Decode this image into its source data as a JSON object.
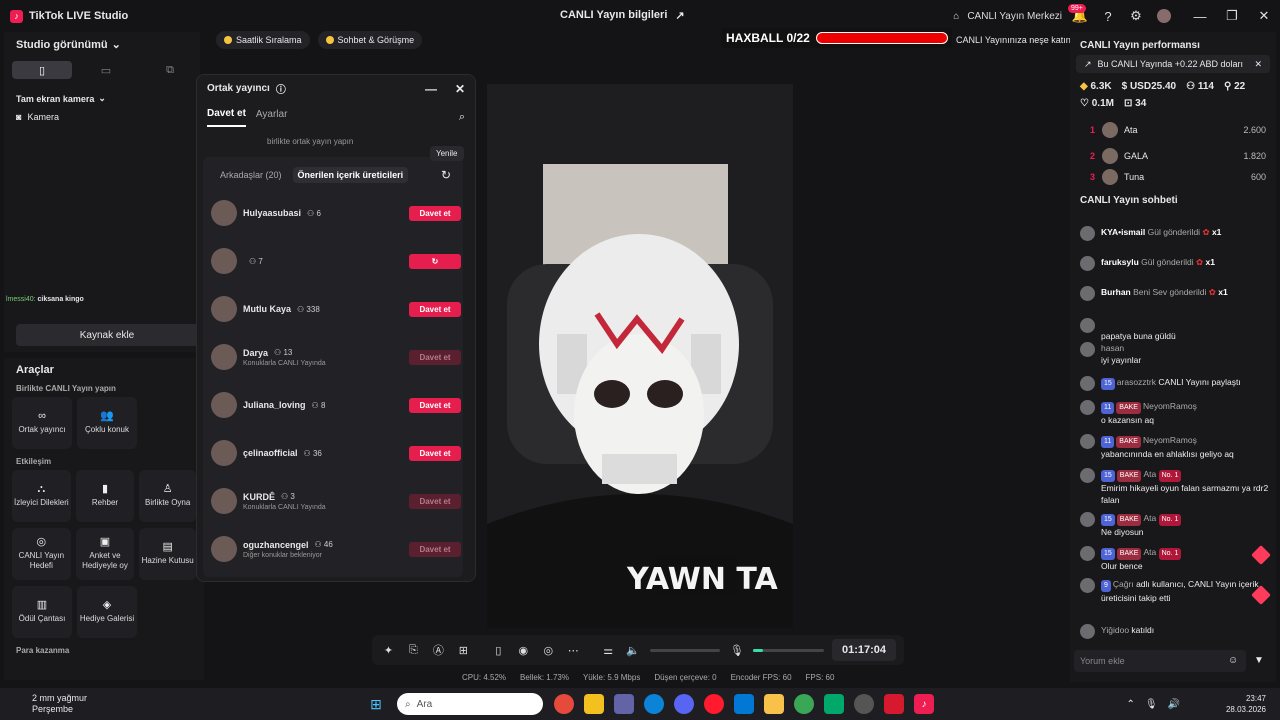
{
  "app": {
    "title": "TikTok LIVE Studio",
    "center_title": "CANLI Yayın bilgileri",
    "center_link": "CANLI Yayın Merkezi",
    "badge": "99+"
  },
  "left": {
    "view": "Studio görünümü",
    "scene": "Tam ekran kamera",
    "source": "Kamera",
    "chat_user": "lmessi40:",
    "chat_text": "ciksana kingo",
    "add_source": "Kaynak ekle"
  },
  "tools": {
    "title": "Araçlar",
    "sec1": "Birlikte CANLI Yayın yapın",
    "sec2": "Etkileşim",
    "sec3": "Para kazanma",
    "cards1": [
      "Ortak yayıncı",
      "Çoklu konuk"
    ],
    "cards2": [
      "İzleyici Dilekleri",
      "Rehber",
      "Birlikte Oyna"
    ],
    "cards3": [
      "CANLI Yayın Hedefi",
      "Anket ve Hediyeyle oy",
      "Hazine Kutusu"
    ],
    "cards4": [
      "Ödül Çantası",
      "Hediye Galerisi"
    ]
  },
  "tags": [
    "Saatlik Sıralama",
    "Sohbet & Görüşme"
  ],
  "haxball": {
    "label": "HAXBALL 0/22",
    "progress": 0,
    "note": "CANLI Yayınınıza neşe katın"
  },
  "dialog": {
    "title": "Ortak yayıncı",
    "tab1": "Davet et",
    "tab2": "Ayarlar",
    "top_text": "birlikte ortak yayın yapın",
    "tooltip": "Yenile",
    "filter1": "Arkadaşlar (20)",
    "filter2": "Önerilen içerik üreticileri",
    "creators": [
      {
        "name": "Hulyaasubasi",
        "count": "6",
        "sub": "",
        "btn": "Davet et",
        "state": "on"
      },
      {
        "name": "",
        "count": "7",
        "sub": "",
        "btn": "",
        "state": "loading"
      },
      {
        "name": "Mutlu Kaya",
        "count": "338",
        "sub": "",
        "btn": "Davet et",
        "state": "on"
      },
      {
        "name": "Darya",
        "count": "13",
        "sub": "Konuklarla CANLI Yayında",
        "btn": "Davet et",
        "state": "dis"
      },
      {
        "name": "Juliana_loving",
        "count": "8",
        "sub": "",
        "btn": "Davet et",
        "state": "on"
      },
      {
        "name": "çelinaofficial",
        "count": "36",
        "sub": "",
        "btn": "Davet et",
        "state": "on"
      },
      {
        "name": "KURDÊ",
        "count": "3",
        "sub": "Konuklarla CANLI Yayında",
        "btn": "Davet et",
        "state": "dis"
      },
      {
        "name": "oguzhancengel",
        "count": "46",
        "sub": "Diğer konuklar bekleniyor",
        "btn": "Davet et",
        "state": "dis"
      }
    ]
  },
  "video": {
    "shirt_text": "YAWN TA"
  },
  "controls": {
    "timer": "01:17:04"
  },
  "stats": [
    "CPU: 4.52%",
    "Bellek: 1.73%",
    "Yükle: 5.9 Mbps",
    "Düşen çerçeve: 0",
    "Encoder FPS: 60",
    "FPS: 60"
  ],
  "right": {
    "perf_title": "CANLI Yayın performansı",
    "notice": "Bu CANLI Yayında +0.22 ABD doları",
    "metrics": [
      "6.3K",
      "USD25.40",
      "114",
      "22",
      "0.1M",
      "34"
    ],
    "ranks": [
      {
        "n": "1",
        "name": "Ata",
        "score": "2.600"
      },
      {
        "n": "2",
        "name": "GALA",
        "score": "1.820"
      },
      {
        "n": "3",
        "name": "Tuna",
        "score": "600"
      }
    ],
    "chat_title": "CANLI Yayın sohbeti",
    "gifts": [
      {
        "user": "KYA•ismail",
        "action": "Gül gönderildi",
        "mult": "x1"
      },
      {
        "user": "faruksylu",
        "action": "Gül gönderildi",
        "mult": "x1"
      },
      {
        "user": "Burhan",
        "action": "Beni Sev gönderildi",
        "mult": "x1"
      }
    ],
    "messages": [
      {
        "user": "",
        "text": "papatya buna güldü"
      },
      {
        "user": "hasan",
        "text": "iyi yayınlar"
      },
      {
        "user": "arasozztrk",
        "level": "15",
        "text": "CANLI Yayını paylaştı"
      },
      {
        "user": "NeyomRamoş",
        "level": "11",
        "bake": "BAKE",
        "text": "o kazansın aq"
      },
      {
        "user": "NeyomRamoş",
        "level": "11",
        "bake": "BAKE",
        "text": "yabancınında en ahlaklısı geliyo aq"
      },
      {
        "user": "Ata",
        "level": "15",
        "bake": "BAKE",
        "no1": "No. 1",
        "text": "Emirim hikayeli oyun falan sarmazmı ya rdr2 falan"
      },
      {
        "user": "Ata",
        "level": "15",
        "bake": "BAKE",
        "no1": "No. 1",
        "text": "Ne diyosun"
      },
      {
        "user": "Ata",
        "level": "15",
        "bake": "BAKE",
        "no1": "No. 1",
        "text": "Olur bence"
      },
      {
        "user": "Çağrı",
        "level": "9",
        "text": "adlı kullanıcı, CANLI Yayın içerik üreticisini takip etti"
      },
      {
        "user": "Yiğidoo",
        "text": "katıldı"
      }
    ],
    "comment_placeholder": "Yorum ekle"
  },
  "taskbar": {
    "weather": "2 mm yağmur",
    "weather_sub": "Perşembe",
    "search": "Ara",
    "time": "23:47",
    "date": "28.03.2026"
  },
  "colors": {
    "accent": "#ee1d52",
    "bg": "#141416"
  }
}
